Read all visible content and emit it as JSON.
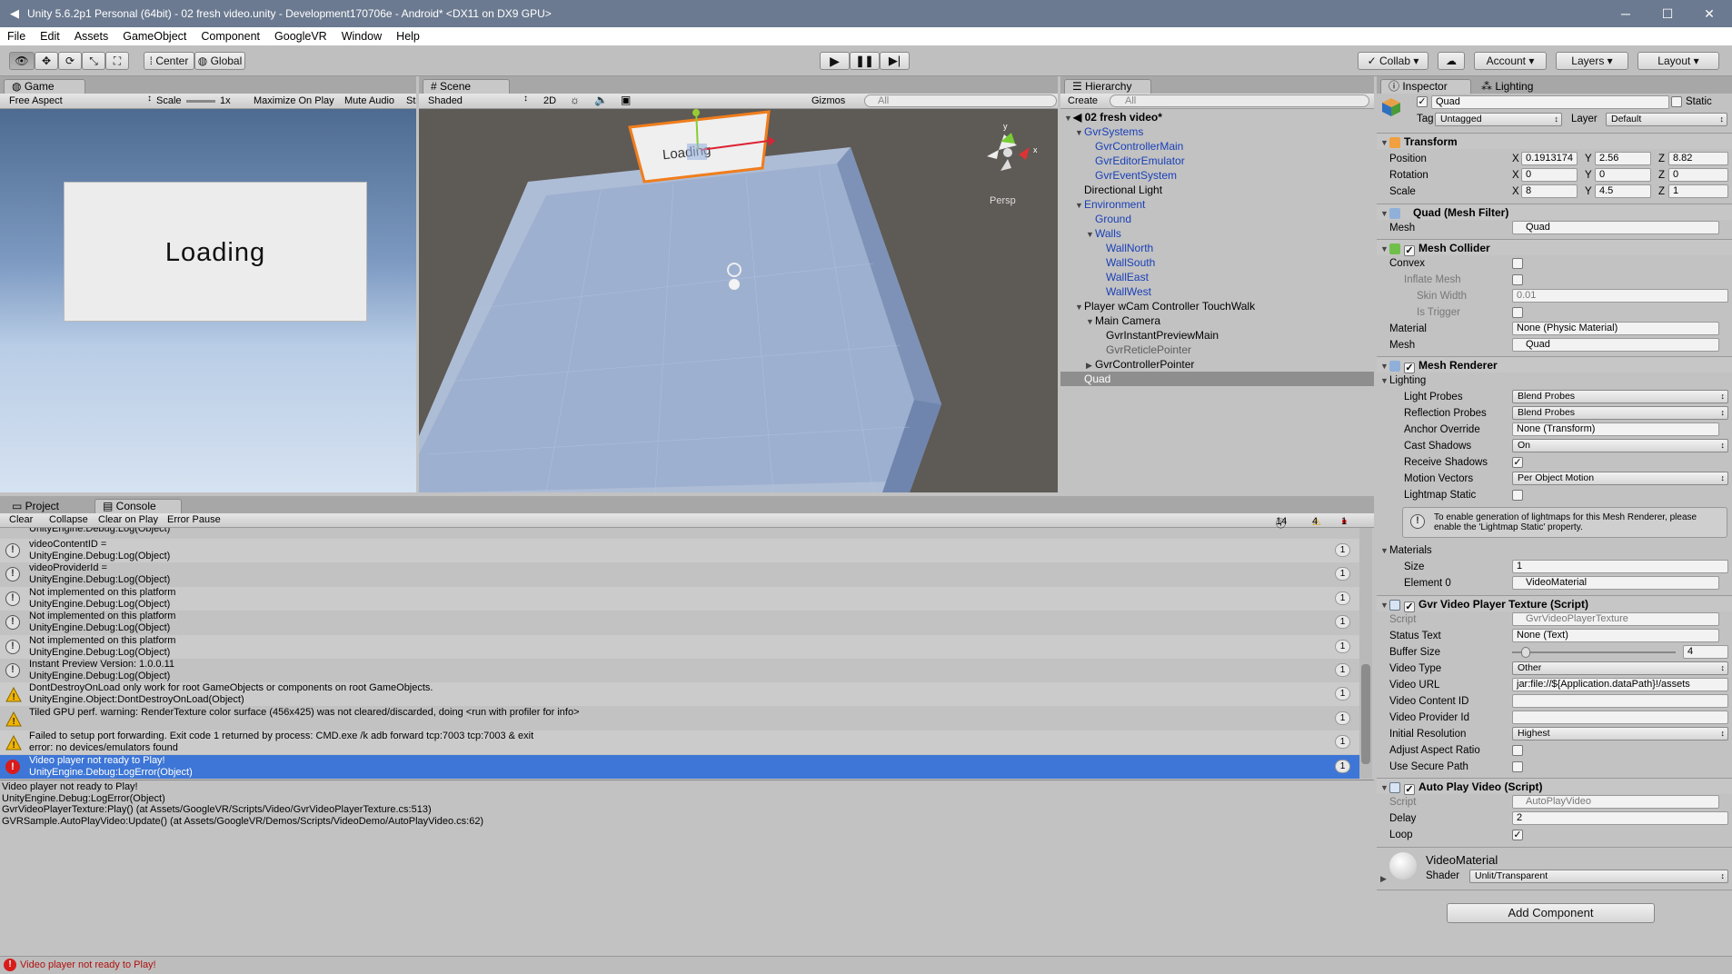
{
  "window": {
    "title": "Unity 5.6.2p1 Personal (64bit) - 02 fresh video.unity - Development170706e - Android* <DX11 on DX9 GPU>",
    "minimize": "─",
    "maximize": "☐",
    "close": "✕"
  },
  "menu": [
    "File",
    "Edit",
    "Assets",
    "GameObject",
    "Component",
    "GoogleVR",
    "Window",
    "Help"
  ],
  "toolbar": {
    "center": "Center",
    "global": "Global",
    "collab": "Collab ▾",
    "account": "Account",
    "layers": "Layers",
    "layout": "Layout"
  },
  "game": {
    "tab": "Game",
    "aspect": "Free Aspect",
    "scale_label": "Scale",
    "scale_value": "1x",
    "maximize": "Maximize On Play",
    "mute": "Mute Audio",
    "stats": "St",
    "loading_text": "Loading"
  },
  "scene": {
    "tab": "Scene",
    "shading": "Shaded",
    "mode2d": "2D",
    "gizmos": "Gizmos",
    "search_placeholder": "All",
    "quad_text": "Loading",
    "persp": "Persp",
    "axis_y": "y",
    "axis_x": "x"
  },
  "hierarchy": {
    "tab": "Hierarchy",
    "create": "Create",
    "search_placeholder": "All",
    "scene": "02 fresh video*",
    "items": [
      {
        "label": "GvrSystems",
        "depth": 1,
        "tri": "▼",
        "style": "blue"
      },
      {
        "label": "GvrControllerMain",
        "depth": 2,
        "tri": "",
        "style": "blue"
      },
      {
        "label": "GvrEditorEmulator",
        "depth": 2,
        "tri": "",
        "style": "blue"
      },
      {
        "label": "GvrEventSystem",
        "depth": 2,
        "tri": "",
        "style": "blue"
      },
      {
        "label": "Directional Light",
        "depth": 1,
        "tri": "",
        "style": ""
      },
      {
        "label": "Environment",
        "depth": 1,
        "tri": "▼",
        "style": "blue"
      },
      {
        "label": "Ground",
        "depth": 2,
        "tri": "",
        "style": "blue"
      },
      {
        "label": "Walls",
        "depth": 2,
        "tri": "▼",
        "style": "blue"
      },
      {
        "label": "WallNorth",
        "depth": 3,
        "tri": "",
        "style": "blue"
      },
      {
        "label": "WallSouth",
        "depth": 3,
        "tri": "",
        "style": "blue"
      },
      {
        "label": "WallEast",
        "depth": 3,
        "tri": "",
        "style": "blue"
      },
      {
        "label": "WallWest",
        "depth": 3,
        "tri": "",
        "style": "blue"
      },
      {
        "label": "Player wCam Controller TouchWalk",
        "depth": 1,
        "tri": "▼",
        "style": ""
      },
      {
        "label": "Main Camera",
        "depth": 2,
        "tri": "▼",
        "style": ""
      },
      {
        "label": "GvrInstantPreviewMain",
        "depth": 3,
        "tri": "",
        "style": ""
      },
      {
        "label": "GvrReticlePointer",
        "depth": 3,
        "tri": "",
        "style": "grey"
      },
      {
        "label": "GvrControllerPointer",
        "depth": 2,
        "tri": "▶",
        "style": ""
      },
      {
        "label": "Quad",
        "depth": 1,
        "tri": "",
        "style": "sel"
      }
    ]
  },
  "inspector": {
    "tab": "Inspector",
    "lighting_tab": "Lighting",
    "name": "Quad",
    "static": "Static",
    "tag_label": "Tag",
    "tag": "Untagged",
    "layer_label": "Layer",
    "layer": "Default",
    "transform": {
      "title": "Transform",
      "position": "Position",
      "rotation": "Rotation",
      "scale": "Scale",
      "px": "0.1913174",
      "py": "2.56",
      "pz": "8.82",
      "rx": "0",
      "ry": "0",
      "rz": "0",
      "sx": "8",
      "sy": "4.5",
      "sz": "1"
    },
    "mesh_filter": {
      "title": "Quad (Mesh Filter)",
      "mesh_label": "Mesh",
      "mesh": "Quad"
    },
    "mesh_collider": {
      "title": "Mesh Collider",
      "convex": "Convex",
      "inflate": "Inflate Mesh",
      "skin": "Skin Width",
      "skin_value": "0.01",
      "trigger": "Is Trigger",
      "material_label": "Material",
      "material": "None (Physic Material)",
      "mesh_label": "Mesh",
      "mesh": "Quad"
    },
    "mesh_renderer": {
      "title": "Mesh Renderer",
      "lighting": "Lighting",
      "light_probes": "Light Probes",
      "light_probes_value": "Blend Probes",
      "reflection": "Reflection Probes",
      "reflection_value": "Blend Probes",
      "anchor": "Anchor Override",
      "anchor_value": "None (Transform)",
      "cast": "Cast Shadows",
      "cast_value": "On",
      "receive": "Receive Shadows",
      "motion": "Motion Vectors",
      "motion_value": "Per Object Motion",
      "lightmap": "Lightmap Static",
      "info": "To enable generation of lightmaps for this Mesh Renderer, please enable the 'Lightmap Static' property.",
      "materials": "Materials",
      "size_label": "Size",
      "size": "1",
      "element": "Element 0",
      "element_value": "VideoMaterial"
    },
    "gvr": {
      "title": "Gvr Video Player Texture (Script)",
      "script": "Script",
      "script_value": "GvrVideoPlayerTexture",
      "status": "Status Text",
      "status_value": "None (Text)",
      "buffer": "Buffer Size",
      "buffer_value": "4",
      "buffer_level": 0.06,
      "type": "Video Type",
      "type_value": "Other",
      "url": "Video URL",
      "url_value": "jar:file://${Application.dataPath}!/assets",
      "content": "Video Content ID",
      "provider": "Video Provider Id",
      "resolution": "Initial Resolution",
      "resolution_value": "Highest",
      "aspect": "Adjust Aspect Ratio",
      "secure": "Use Secure Path"
    },
    "autoplay": {
      "title": "Auto Play Video (Script)",
      "script": "Script",
      "script_value": "AutoPlayVideo",
      "delay": "Delay",
      "delay_value": "2",
      "loop": "Loop"
    },
    "material": {
      "name": "VideoMaterial",
      "shader_label": "Shader",
      "shader": "Unlit/Transparent"
    },
    "add_component": "Add Component"
  },
  "console": {
    "project_tab": "Project",
    "tab": "Console",
    "clear": "Clear",
    "collapse": "Collapse",
    "clear_on_play": "Clear on Play",
    "error_pause": "Error Pause",
    "info_count": "14",
    "warn_count": "4",
    "err_count": "1",
    "top_partial": "UnityEngine.Debug:Log(Object)",
    "entries": [
      {
        "type": "info",
        "l1": "videoContentID =",
        "l2": "UnityEngine.Debug:Log(Object)",
        "count": "1"
      },
      {
        "type": "info",
        "l1": "videoProviderId =",
        "l2": "UnityEngine.Debug:Log(Object)",
        "count": "1"
      },
      {
        "type": "info",
        "l1": "Not implemented on this platform",
        "l2": "UnityEngine.Debug:Log(Object)",
        "count": "1"
      },
      {
        "type": "info",
        "l1": "Not implemented on this platform",
        "l2": "UnityEngine.Debug:Log(Object)",
        "count": "1"
      },
      {
        "type": "info",
        "l1": "Not implemented on this platform",
        "l2": "UnityEngine.Debug:Log(Object)",
        "count": "1"
      },
      {
        "type": "info",
        "l1": "Instant Preview Version: 1.0.0.11",
        "l2": "UnityEngine.Debug:Log(Object)",
        "count": "1"
      },
      {
        "type": "warn",
        "l1": "DontDestroyOnLoad only work for root GameObjects or components on root GameObjects.",
        "l2": "UnityEngine.Object:DontDestroyOnLoad(Object)",
        "count": "1"
      },
      {
        "type": "warn",
        "l1": "Tiled GPU perf. warning: RenderTexture color surface  (456x425) was not cleared/discarded, doing <run with profiler for info>",
        "l2": "",
        "count": "1"
      },
      {
        "type": "warn",
        "l1": "Failed to setup port forwarding. Exit code 1 returned by process: CMD.exe /k adb forward tcp:7003 tcp:7003 & exit",
        "l2": "error: no devices/emulators found",
        "count": "1"
      },
      {
        "type": "err",
        "l1": "Video player not ready to Play!",
        "l2": "UnityEngine.Debug:LogError(Object)",
        "count": "1"
      }
    ],
    "detail": [
      "Video player not ready to Play!",
      "UnityEngine.Debug:LogError(Object)",
      "GvrVideoPlayerTexture:Play() (at Assets/GoogleVR/Scripts/Video/GvrVideoPlayerTexture.cs:513)",
      "GVRSample.AutoPlayVideo:Update() (at Assets/GoogleVR/Demos/Scripts/VideoDemo/AutoPlayVideo.cs:62)"
    ]
  },
  "status_bar": "Video player not ready to Play!"
}
